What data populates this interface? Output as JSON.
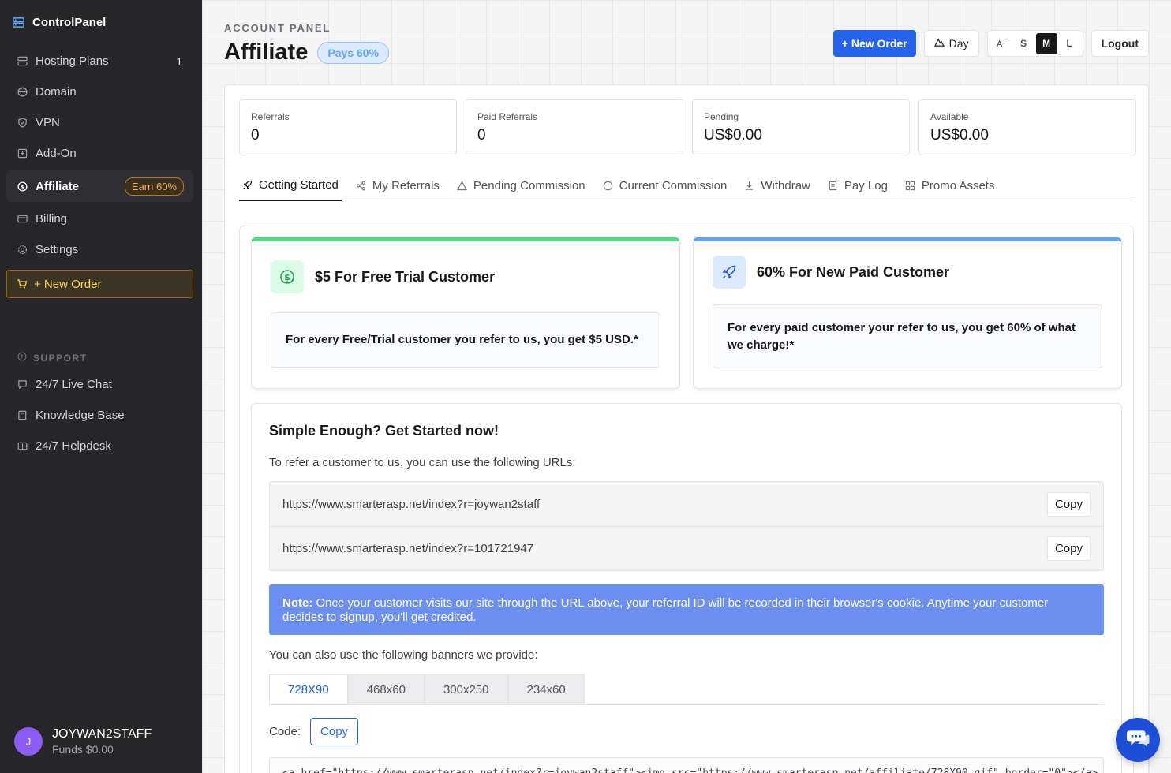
{
  "sidebar": {
    "brand": "ControlPanel",
    "items": [
      {
        "label": "Hosting Plans",
        "count": "1",
        "icon": "server-icon"
      },
      {
        "label": "Domain",
        "icon": "globe-icon"
      },
      {
        "label": "VPN",
        "icon": "shield-icon"
      },
      {
        "label": "Add-On",
        "icon": "plus-square-icon"
      },
      {
        "label": "Affiliate",
        "badge": "Earn 60%",
        "icon": "dollar-circle-icon"
      },
      {
        "label": "Billing",
        "icon": "credit-card-icon"
      },
      {
        "label": "Settings",
        "icon": "gear-icon"
      }
    ],
    "new_order": "+ New Order",
    "support_heading": "SUPPORT",
    "support_items": [
      {
        "label": "24/7 Live Chat",
        "icon": "chat-icon"
      },
      {
        "label": "Knowledge Base",
        "icon": "book-icon"
      },
      {
        "label": "24/7 Helpdesk",
        "icon": "ticket-icon"
      }
    ],
    "user": {
      "initial": "J",
      "name": "JOYWAN2STAFF",
      "funds": "Funds $0.00"
    }
  },
  "header": {
    "eyebrow": "ACCOUNT PANEL",
    "title": "Affiliate",
    "badge": "Pays 60%",
    "new_order": "+ New Order",
    "theme": "Day",
    "sizes": [
      "S",
      "M",
      "L"
    ],
    "active_size": "M",
    "logout": "Logout"
  },
  "stats": [
    {
      "label": "Referrals",
      "value": "0"
    },
    {
      "label": "Paid Referrals",
      "value": "0"
    },
    {
      "label": "Pending",
      "value": "US$0.00"
    },
    {
      "label": "Available",
      "value": "US$0.00"
    }
  ],
  "tabs": [
    {
      "label": "Getting Started",
      "icon": "rocket-icon"
    },
    {
      "label": "My Referrals",
      "icon": "share-icon"
    },
    {
      "label": "Pending Commission",
      "icon": "warning-icon"
    },
    {
      "label": "Current Commission",
      "icon": "coin-icon"
    },
    {
      "label": "Withdraw",
      "icon": "download-icon"
    },
    {
      "label": "Pay Log",
      "icon": "receipt-icon"
    },
    {
      "label": "Promo Assets",
      "icon": "grid-icon"
    }
  ],
  "offers": [
    {
      "title": "$5 For Free Trial Customer",
      "body": "For every Free/Trial customer you refer to us, you get $5 USD.*"
    },
    {
      "title": "60% For New Paid Customer",
      "body": "For every paid customer your refer to us, you get 60% of what we charge!*"
    }
  ],
  "getting_started": {
    "title": "Simple Enough? Get Started now!",
    "subtitle": "To refer a customer to us, you can use the following URLs:",
    "urls": [
      "https://www.smarterasp.net/index?r=joywan2staff",
      "https://www.smarterasp.net/index?r=101721947"
    ],
    "copy_label": "Copy",
    "note_label": "Note:",
    "note_text": " Once your customer visits our site through the URL above, your referral ID will be recorded in their browser's cookie. Anytime your customer decides to signup, you'll get credited.",
    "banners_text": "You can also use the following banners we provide:",
    "banner_sizes": [
      "728X90",
      "468x60",
      "300x250",
      "234x60"
    ],
    "code_label": "Code:",
    "code_copy": "Copy",
    "code_value": "<a href=\"https://www.smarterasp.net/index?r=joywan2staff\"><img src=\"https://www.smarterasp.net/affiliate/728X90.gif\" border=\"0\"></a>"
  },
  "colors": {
    "accent": "#2563eb",
    "sidebar_bg": "#27272a",
    "earn_badge": "#f6ad55",
    "note_bg": "#6b8ff0"
  }
}
